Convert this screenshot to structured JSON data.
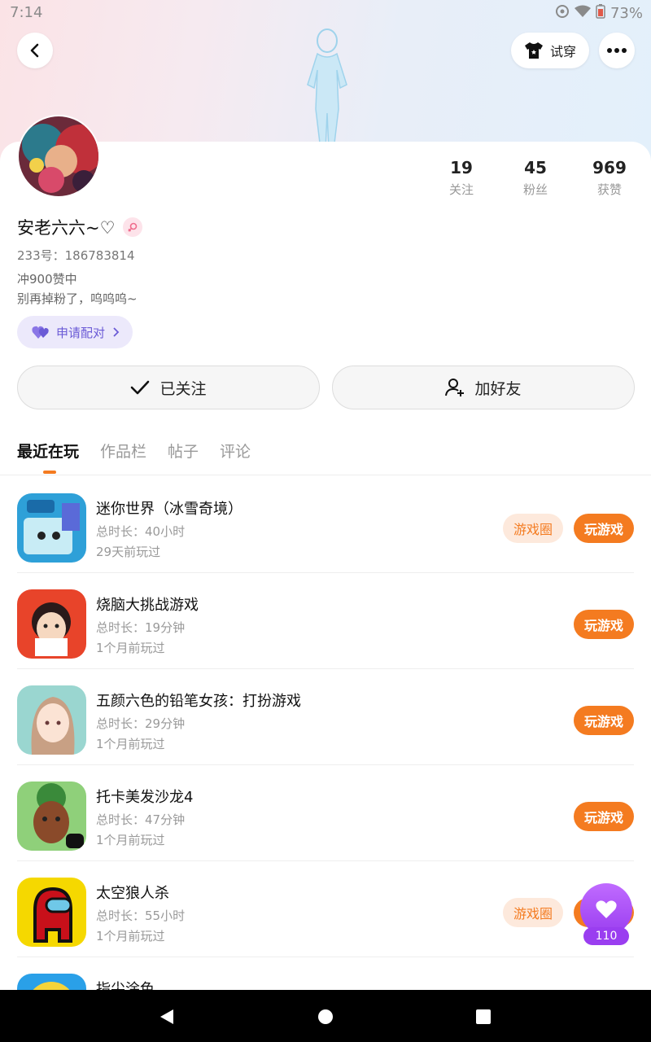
{
  "status_bar": {
    "time": "7:14",
    "battery": "73%"
  },
  "header": {
    "tryon_label": "试穿"
  },
  "profile": {
    "nickname": "安老六六~♡",
    "uid": "233号：186783814",
    "bio_line1": "冲900赞中",
    "bio_line2": "别再掉粉了，呜呜呜~",
    "match_label": "申请配对"
  },
  "stats": [
    {
      "value": "19",
      "label": "关注"
    },
    {
      "value": "45",
      "label": "粉丝"
    },
    {
      "value": "969",
      "label": "获赞"
    }
  ],
  "actions": {
    "following_label": "已关注",
    "add_friend_label": "加好友"
  },
  "tabs": [
    "最近在玩",
    "作品栏",
    "帖子",
    "评论"
  ],
  "games": [
    {
      "name": "迷你世界（冰雪奇境）",
      "duration": "总时长：40小时",
      "last_played": "29天前玩过",
      "circle_label": "游戏圈",
      "play_label": "玩游戏"
    },
    {
      "name": "烧脑大挑战游戏",
      "duration": "总时长：19分钟",
      "last_played": "1个月前玩过",
      "play_label": "玩游戏"
    },
    {
      "name": "五颜六色的铅笔女孩：打扮游戏",
      "duration": "总时长：29分钟",
      "last_played": "1个月前玩过",
      "play_label": "玩游戏"
    },
    {
      "name": "托卡美发沙龙4",
      "duration": "总时长：47分钟",
      "last_played": "1个月前玩过",
      "play_label": "玩游戏"
    },
    {
      "name": "太空狼人杀",
      "duration": "总时长：55小时",
      "last_played": "1个月前玩过",
      "circle_label": "游戏圈",
      "play_label": "玩游戏"
    },
    {
      "name": "指尖涂色"
    }
  ],
  "like_float": {
    "count": "110"
  },
  "colors": {
    "accent": "#f47b20",
    "purple": "#9a3ef0"
  }
}
